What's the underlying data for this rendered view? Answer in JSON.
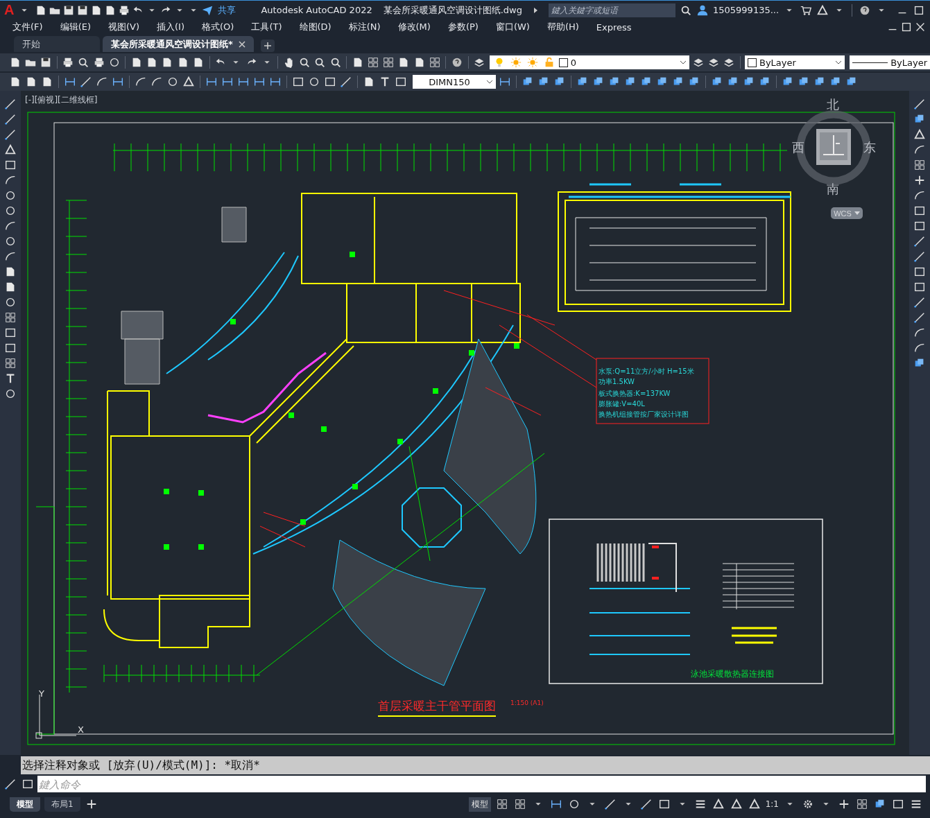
{
  "title_bar": {
    "app_logo": "A",
    "share": "共享",
    "app": "Autodesk AutoCAD 2022",
    "file": "某会所采暖通风空调设计图纸.dwg",
    "search_placeholder": "鍵入关鍵字或短语",
    "user": "1505999135..."
  },
  "menu": [
    "文件(F)",
    "编辑(E)",
    "视图(V)",
    "插入(I)",
    "格式(O)",
    "工具(T)",
    "绘图(D)",
    "标注(N)",
    "修改(M)",
    "参数(P)",
    "窗口(W)",
    "帮助(H)",
    "Express"
  ],
  "file_tabs": [
    {
      "label": "开始",
      "selected": false,
      "closable": false
    },
    {
      "label": "某会所采暖通风空调设计图纸*",
      "selected": true,
      "closable": true
    }
  ],
  "layer_toolbar": {
    "layer": "0",
    "color_control": "ByLayer",
    "linetype": "ByLayer"
  },
  "dim_style": "DIMN150",
  "viewport_label": "[-][俯视][二维线框]",
  "viewcube": {
    "north": "北",
    "south": "南",
    "east": "东",
    "west": "西",
    "coordinate_system": "WCS"
  },
  "drawing": {
    "title": "首层采暖主干管平面图",
    "scale": "1:150 (A1)",
    "detail_title": "泳池采暖散热器连接图",
    "equipment_notes": [
      "水泵:Q=11立方/小时 H=15米",
      "功率1.5KW",
      "板式换热器:K=137KW",
      "膨胀罐:V=40L",
      "换热机组接管按厂家设计详图"
    ],
    "ucs_labels": [
      "Y",
      "X"
    ]
  },
  "command_line": {
    "history": "选择注释对象或 [放弃(U)/模式(M)]: *取消*",
    "placeholder": "鍵入命令"
  },
  "layout_tabs": [
    {
      "label": "模型",
      "selected": true
    },
    {
      "label": "布局1",
      "selected": false
    }
  ],
  "status_bar": {
    "space": "模型",
    "annotation_scale": "1:1"
  }
}
